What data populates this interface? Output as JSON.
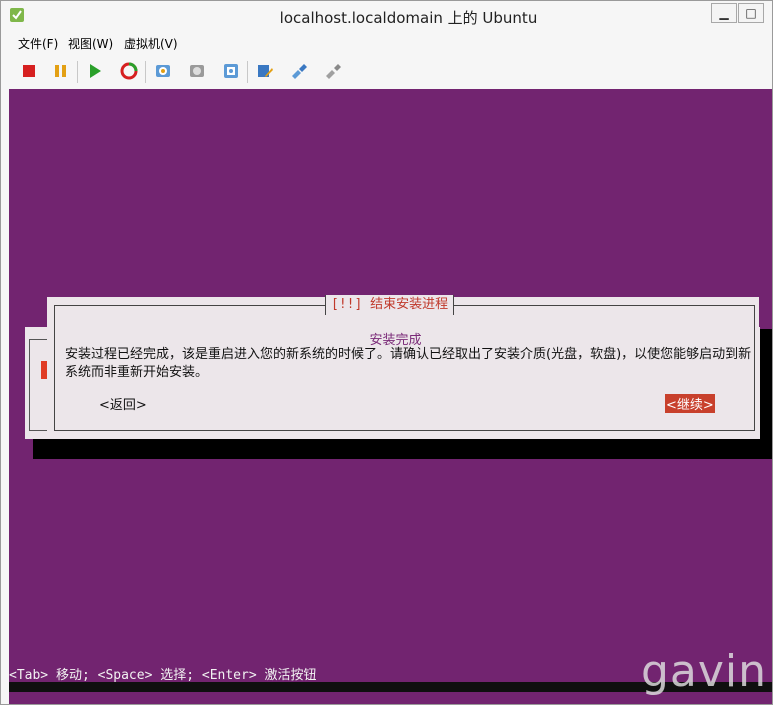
{
  "window": {
    "title": "localhost.localdomain 上的 Ubuntu",
    "min_glyph": "▁",
    "max_glyph": "□",
    "close_glyph": "✕"
  },
  "menu": [
    {
      "label": "文件(F)"
    },
    {
      "label": "视图(W)"
    },
    {
      "label": "虚拟机(V)"
    }
  ],
  "toolbar": {
    "icons": [
      "stop-icon",
      "pause-icon",
      "play-icon",
      "reset-icon",
      "snapshot-icon",
      "revert-snapshot-icon",
      "snapshot-manager-icon",
      "edit-settings-icon",
      "connect-device-icon",
      "disconnect-device-icon"
    ]
  },
  "dialog": {
    "title": "[!!] 结束安装进程",
    "subtitle": "安装完成",
    "message": "安装过程已经完成，该是重启进入您的新系统的时候了。请确认已经取出了安装介质(光盘，软盘)，以使您能够启动到新系统而非重新开始安装。",
    "back_label": "<返回>",
    "continue_label": "<继续>"
  },
  "status_line": "<Tab> 移动; <Space> 选择; <Enter> 激活按钮",
  "watermark": "gavin",
  "colors": {
    "console_bg": "#722470",
    "dialog_bg": "#ece6ea",
    "accent_red": "#c8402c",
    "title_red": "#c0392b"
  }
}
